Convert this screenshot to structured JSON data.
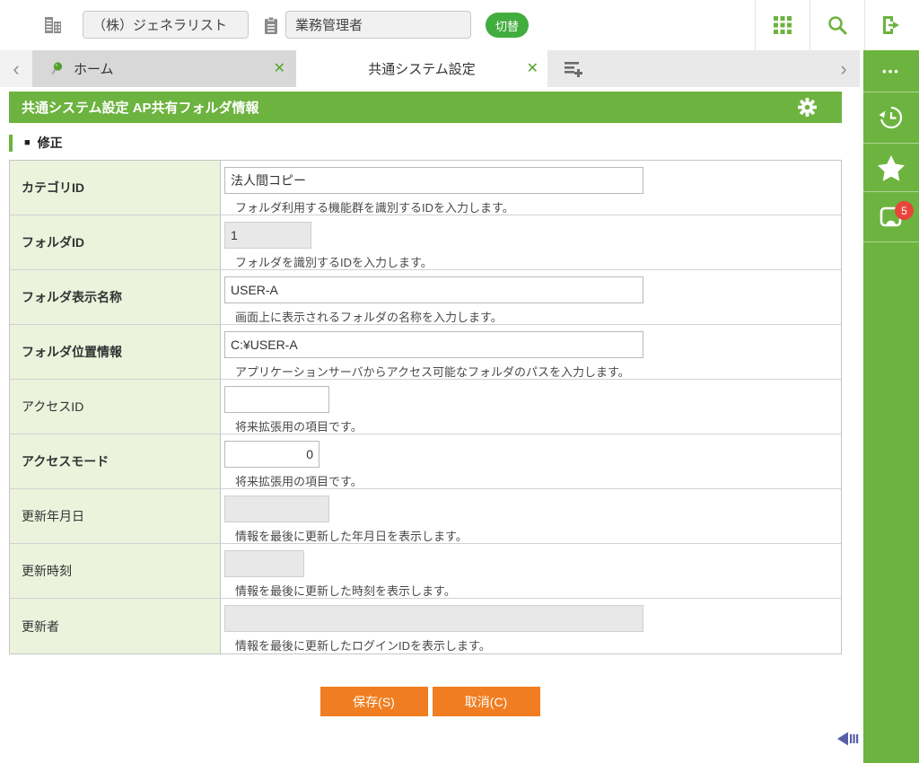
{
  "header": {
    "company": {
      "value": "（株）ジェネラリスト"
    },
    "role": {
      "value": "業務管理者"
    },
    "switch_label": "切替"
  },
  "tabbar": {
    "prev": "‹",
    "next": "›",
    "close_glyph": "✕",
    "tabs": [
      {
        "label": "ホーム",
        "pinned": true,
        "active": false
      },
      {
        "label": "共通システム設定",
        "pinned": false,
        "active": true
      }
    ]
  },
  "titlebar": {
    "title": "共通システム設定 AP共有フォルダ情報"
  },
  "section": {
    "marker": "■",
    "label": "修正"
  },
  "form": {
    "rows": [
      {
        "label": "カテゴリID",
        "bold": true,
        "value": "法人間コピー",
        "help": "フォルダ利用する機能群を識別するIDを入力します。",
        "disabled": false,
        "align": "left",
        "input_width": 467
      },
      {
        "label": "フォルダID",
        "bold": true,
        "value": "1",
        "help": "フォルダを識別するIDを入力します。",
        "disabled": true,
        "align": "left",
        "input_width": 97
      },
      {
        "label": "フォルダ表示名称",
        "bold": true,
        "value": "USER-A",
        "help": "画面上に表示されるフォルダの名称を入力します。",
        "disabled": false,
        "align": "left",
        "input_width": 467
      },
      {
        "label": "フォルダ位置情報",
        "bold": true,
        "value": "C:¥USER-A",
        "help": "アプリケーションサーバからアクセス可能なフォルダのパスを入力します。",
        "disabled": false,
        "align": "left",
        "input_width": 467
      },
      {
        "label": "アクセスID",
        "bold": false,
        "value": "",
        "help": "将来拡張用の項目です。",
        "disabled": false,
        "align": "left",
        "input_width": 117
      },
      {
        "label": "アクセスモード",
        "bold": true,
        "value": "0",
        "help": "将来拡張用の項目です。",
        "disabled": false,
        "align": "right",
        "input_width": 106
      },
      {
        "label": "更新年月日",
        "bold": false,
        "value": "",
        "help": "情報を最後に更新した年月日を表示します。",
        "disabled": true,
        "align": "left",
        "input_width": 117
      },
      {
        "label": "更新時刻",
        "bold": false,
        "value": "",
        "help": "情報を最後に更新した時刻を表示します。",
        "disabled": true,
        "align": "left",
        "input_width": 89
      },
      {
        "label": "更新者",
        "bold": false,
        "value": "",
        "help": "情報を最後に更新したログインIDを表示します。",
        "disabled": true,
        "align": "left",
        "input_width": 467
      }
    ]
  },
  "actions": {
    "save": "保存(S)",
    "cancel": "取消(C)"
  },
  "sidebar": {
    "ellipsis": "•••",
    "badge_count": "5"
  },
  "colors": {
    "green": "#6db33f",
    "switch_green": "#41ad3f",
    "orange": "#f07d21",
    "badge_red": "#e8453c",
    "collapse_blue": "#585fa8",
    "label_cell_green": "#ebf3dc"
  }
}
